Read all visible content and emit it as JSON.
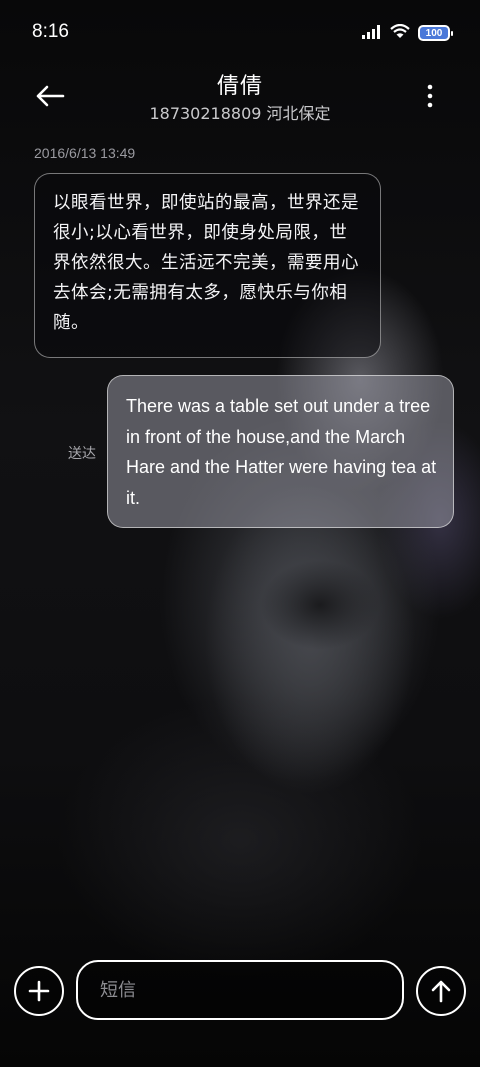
{
  "status_bar": {
    "time": "8:16",
    "battery_level": "100",
    "icons": [
      "signal-icon",
      "wifi-icon",
      "battery-icon"
    ]
  },
  "header": {
    "contact_name": "倩倩",
    "contact_detail": "18730218809 河北保定",
    "icons": [
      "back-arrow-icon",
      "more-vertical-icon"
    ]
  },
  "conversation": {
    "timestamp": "2016/6/13 13:49",
    "incoming_message": "以眼看世界，即使站的最高，世界还是很小;以心看世界，即使身处局限，世界依然很大。生活远不完美，需要用心去体会;无需拥有太多，愿快乐与你相随。",
    "outgoing_message": "There was a table set out under a tree in front of the house,and the March Hare and the Hatter were having tea at it.",
    "outgoing_status": "送达"
  },
  "composer": {
    "placeholder": "短信",
    "value": "",
    "icons": [
      "plus-icon",
      "send-arrow-up-icon"
    ]
  },
  "colors": {
    "background": "#0b0b0c",
    "outgoing_bubble": "#96969f",
    "battery_fill": "#4a78d9"
  }
}
